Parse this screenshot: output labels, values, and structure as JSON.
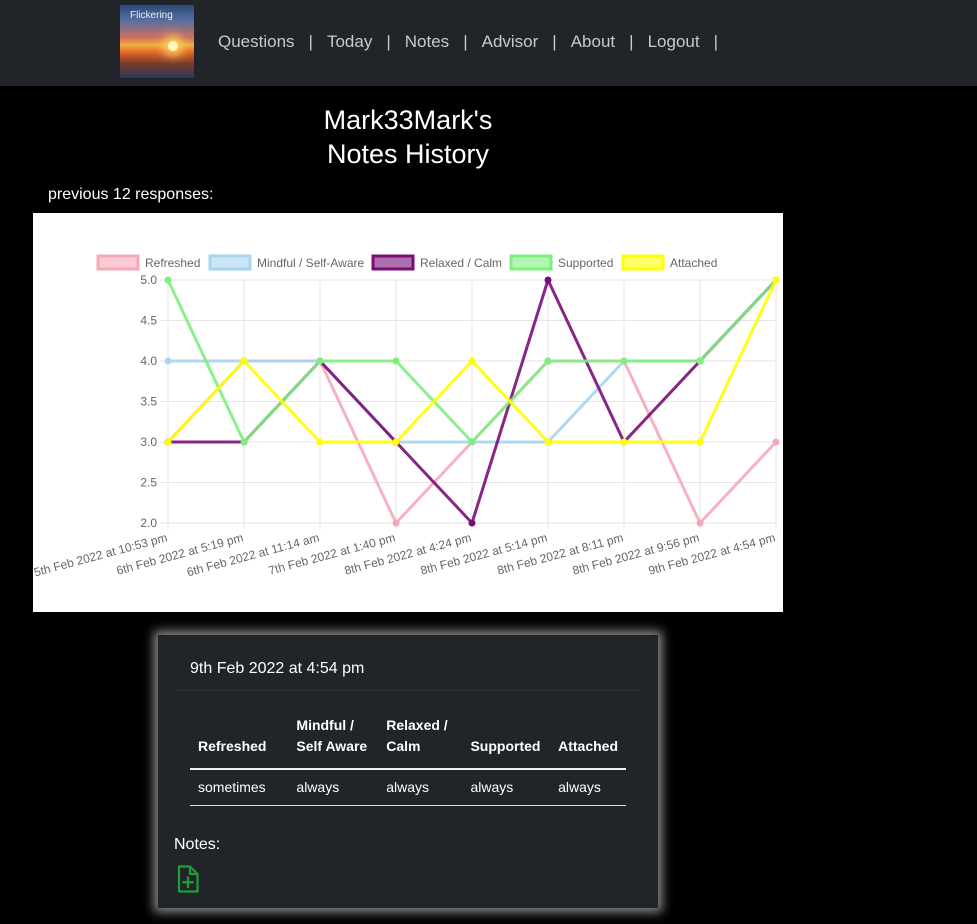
{
  "brand": {
    "logo_text": "Flickering"
  },
  "nav": {
    "items": [
      "Questions",
      "Today",
      "Notes",
      "Advisor",
      "About",
      "Logout"
    ],
    "separator": "|"
  },
  "page": {
    "title_line1": "Mark33Mark's",
    "title_line2": "Notes History",
    "previous_label": "previous 12 responses:"
  },
  "chart_data": {
    "type": "line",
    "categories": [
      "5th Feb 2022 at 10:53 pm",
      "6th Feb 2022 at 5:19 pm",
      "6th Feb 2022 at 11:14 am",
      "7th Feb 2022 at 1:40 pm",
      "8th Feb 2022 at 4:24 pm",
      "8th Feb 2022 at 5:14 pm",
      "8th Feb 2022 at 8:11 pm",
      "8th Feb 2022 at 9:56 pm",
      "9th Feb 2022 at 4:54 pm"
    ],
    "n_points": 9,
    "yticks": [
      "5.0",
      "4.5",
      "4.0",
      "3.5",
      "3.0",
      "2.5",
      "2.0"
    ],
    "ylim": [
      2,
      5
    ],
    "grid": true,
    "legend_position": "top",
    "series": [
      {
        "name": "Refreshed",
        "color": "#f7a8b8",
        "values": [
          3,
          4,
          4,
          2,
          3,
          4,
          4,
          2,
          3
        ]
      },
      {
        "name": "Mindful / Self-Aware",
        "color": "#a8d4f0",
        "values": [
          4,
          4,
          4,
          3,
          3,
          3,
          4,
          4,
          5
        ]
      },
      {
        "name": "Relaxed / Calm",
        "color": "#7a0e78",
        "values": [
          3,
          3,
          4,
          3,
          2,
          5,
          3,
          4,
          5
        ]
      },
      {
        "name": "Supported",
        "color": "#7ef07e",
        "values": [
          5,
          3,
          4,
          4,
          3,
          4,
          4,
          4,
          5
        ]
      },
      {
        "name": "Attached",
        "color": "#ffff00",
        "values": [
          3,
          4,
          3,
          3,
          4,
          3,
          3,
          3,
          5
        ]
      }
    ]
  },
  "card": {
    "date": "9th Feb 2022 at 4:54 pm",
    "headers": [
      "Refreshed",
      "Mindful / Self Aware",
      "Relaxed / Calm",
      "Supported",
      "Attached"
    ],
    "values": [
      "sometimes",
      "always",
      "always",
      "always",
      "always"
    ],
    "notes_label": "Notes:"
  },
  "icons": {
    "add_note": "file-plus-icon"
  },
  "colors": {
    "navbar_bg": "#212529",
    "card_bg": "#212529",
    "add_icon": "#1f9d3a"
  }
}
